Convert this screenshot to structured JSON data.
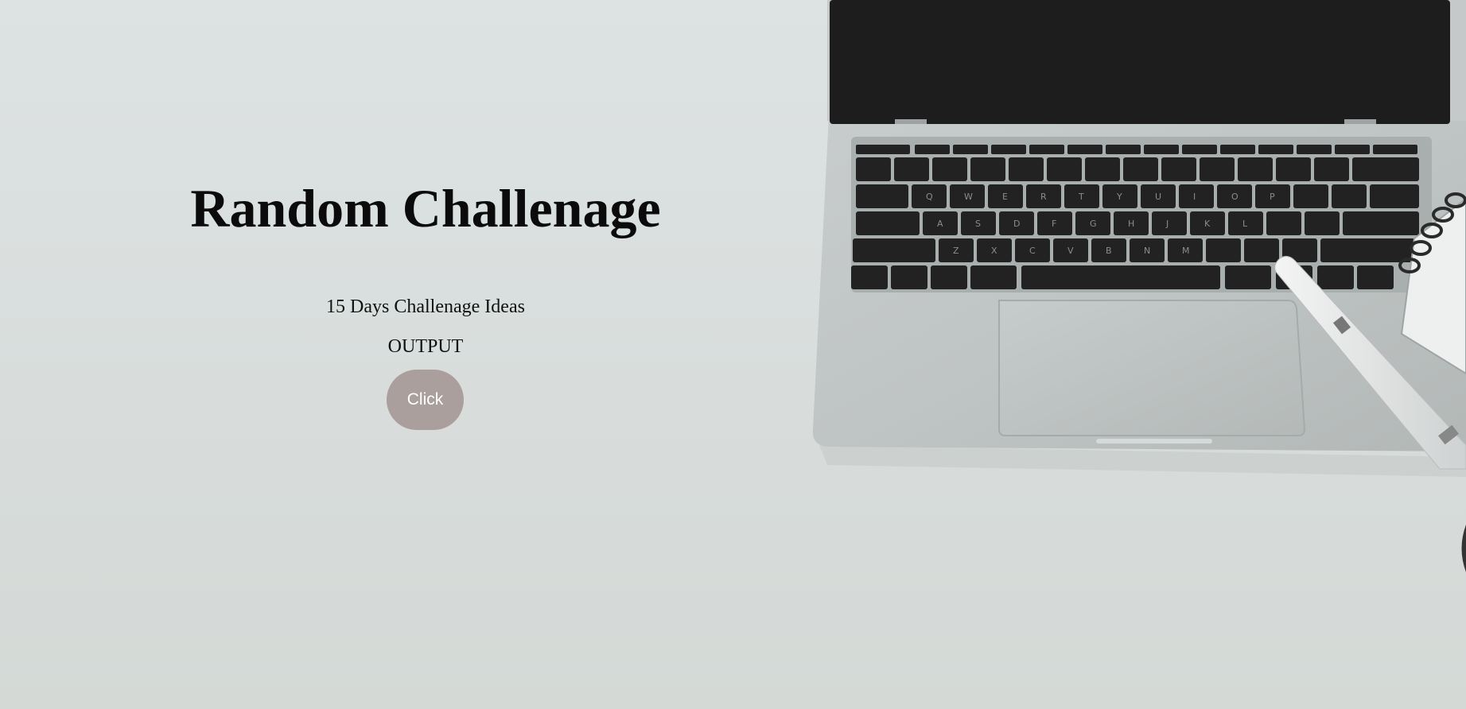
{
  "page": {
    "title": "Random Challenage",
    "subtitle": "15 Days Challenage Ideas",
    "output_text": "OUTPUT",
    "button_label": "Click"
  },
  "colors": {
    "background": "#dde2e3",
    "button": "#ab9f9e",
    "button_text": "#ffffff",
    "title_text": "#0b0b0b"
  },
  "background_image": {
    "description_icon": "laptop-photo"
  }
}
